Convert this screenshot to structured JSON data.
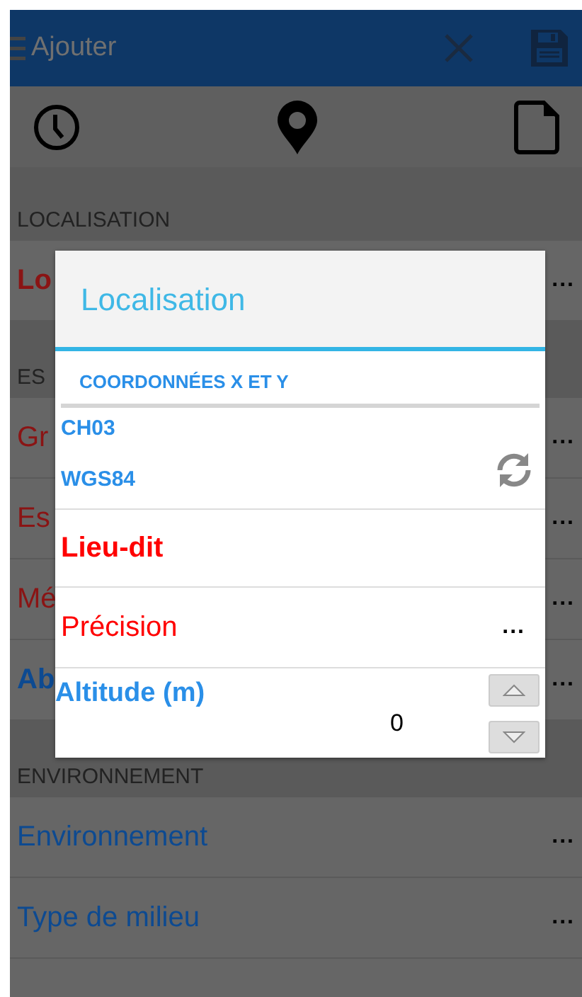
{
  "app_bar": {
    "title": "Ajouter"
  },
  "sections": [
    {
      "header": "LOCALISATION",
      "rows": [
        {
          "label": "Lo",
          "required": true,
          "bold": true,
          "value": "..."
        }
      ]
    },
    {
      "header": "ES",
      "rows": [
        {
          "label": "Gr",
          "required": true,
          "bold": false,
          "value": "..."
        },
        {
          "label": "Es",
          "required": true,
          "bold": false,
          "value": "..."
        },
        {
          "label": "Mé",
          "required": true,
          "bold": false,
          "value": "..."
        },
        {
          "label": "Ab",
          "required": false,
          "bold": true,
          "value": "..."
        }
      ]
    },
    {
      "header": "ENVIRONNEMENT",
      "rows": [
        {
          "label": "Environnement",
          "required": false,
          "bold": false,
          "value": "..."
        },
        {
          "label": "Type de milieu",
          "required": false,
          "bold": false,
          "value": "..."
        }
      ]
    }
  ],
  "dialog": {
    "title": "Localisation",
    "coordinates": {
      "header": "COORDONNÉES X ET Y",
      "systems": [
        "CH03",
        "WGS84"
      ]
    },
    "fields": [
      {
        "kind": "text",
        "label": "Lieu-dit",
        "required": true,
        "bold": true
      },
      {
        "kind": "choice",
        "label": "Précision",
        "required": true,
        "bold": false,
        "value": "..."
      },
      {
        "kind": "number",
        "label": "Altitude (m)",
        "required": false,
        "bold": true,
        "value": "0"
      }
    ]
  }
}
